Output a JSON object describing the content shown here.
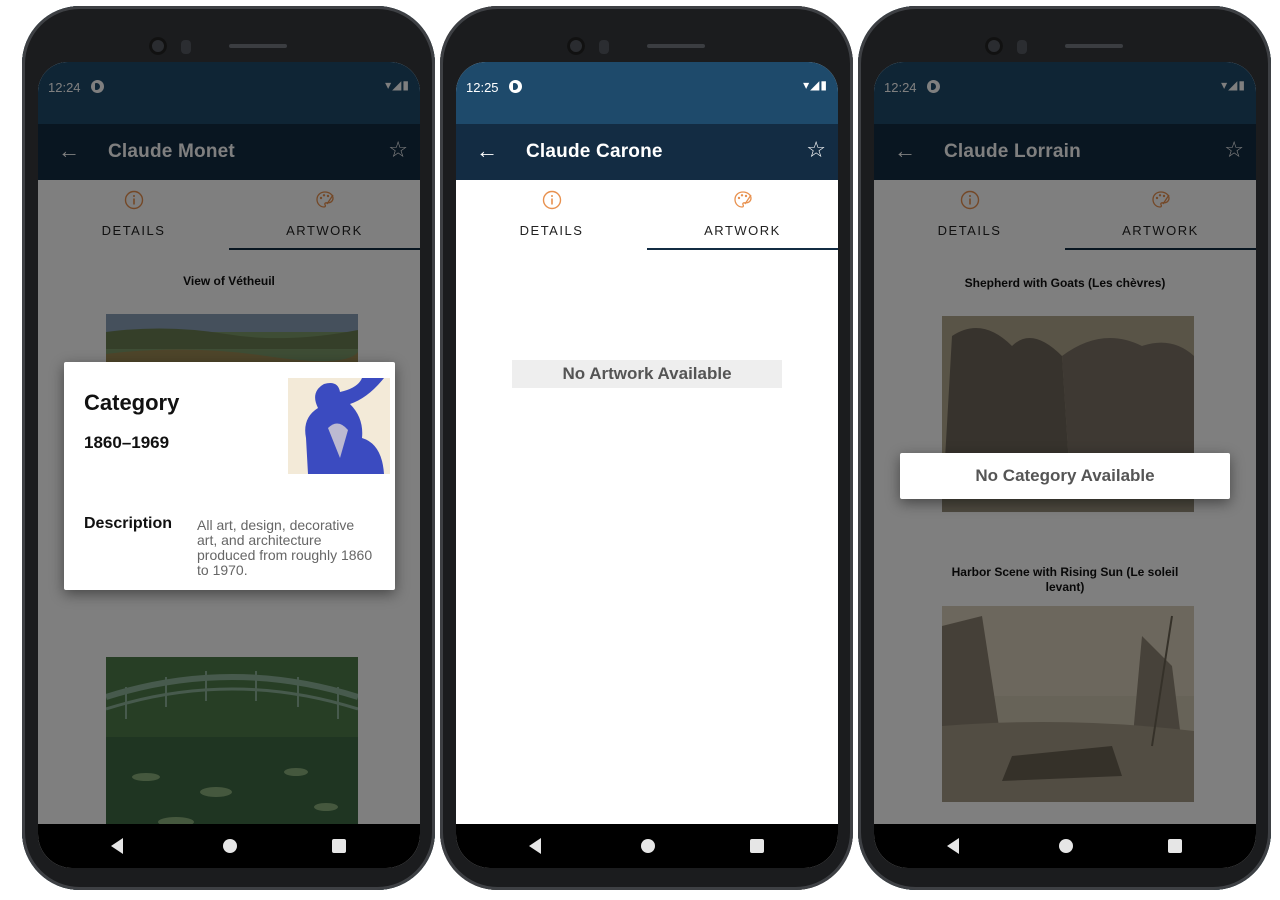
{
  "colors": {
    "statusbar": "#1e4a6b",
    "appbar": "#132c43",
    "accent": "#e8914f"
  },
  "screens": [
    {
      "status_time": "12:24",
      "status_icons": "▾◢▮",
      "title": "Claude Monet",
      "tabs": [
        "DETAILS",
        "ARTWORK"
      ],
      "artworks": [
        {
          "title": "View of Vétheuil"
        }
      ],
      "dialog": {
        "title": "Category",
        "years": "1860–1969",
        "description_label": "Description",
        "description": "All art, design, decorative art, and architecture produced from roughly 1860 to 1970."
      }
    },
    {
      "status_time": "12:25",
      "status_icons": "▾◢▮",
      "title": "Claude Carone",
      "tabs": [
        "DETAILS",
        "ARTWORK"
      ],
      "message": "No Artwork Available"
    },
    {
      "status_time": "12:24",
      "status_icons": "▾◢▮",
      "title": "Claude Lorrain",
      "tabs": [
        "DETAILS",
        "ARTWORK"
      ],
      "artworks": [
        {
          "title": "Shepherd with Goats (Les chèvres)"
        },
        {
          "title": "Harbor Scene with Rising Sun (Le soleil levant)"
        }
      ],
      "dialog": {
        "message": "No Category Available"
      }
    }
  ],
  "icons": {
    "back": "arrow-left-icon",
    "favorite": "star-outline-icon",
    "details_tab": "info-circle-icon",
    "artwork_tab": "palette-icon"
  }
}
